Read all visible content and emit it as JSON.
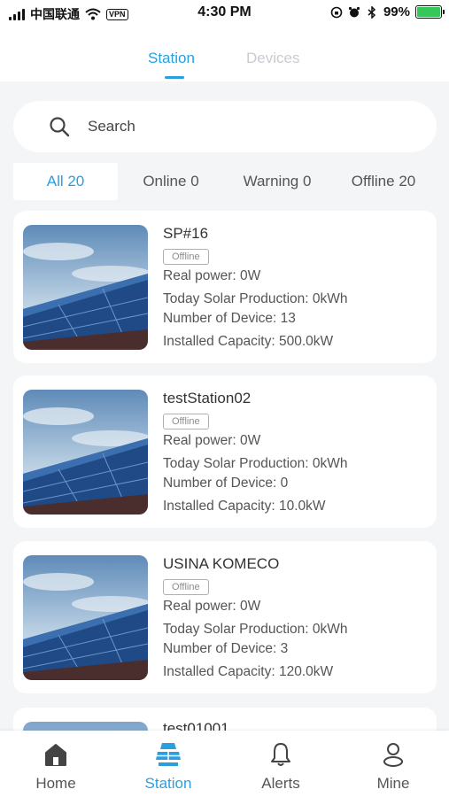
{
  "status_bar": {
    "carrier": "中国联通",
    "vpn": "VPN",
    "time": "4:30 PM",
    "battery": "99%"
  },
  "top_tabs": [
    {
      "label": "Station",
      "active": true
    },
    {
      "label": "Devices",
      "active": false
    }
  ],
  "search": {
    "placeholder": "Search",
    "value": ""
  },
  "filters": [
    {
      "label": "All 20",
      "active": true
    },
    {
      "label": "Online 0",
      "active": false
    },
    {
      "label": "Warning 0",
      "active": false
    },
    {
      "label": "Offline 20",
      "active": false
    }
  ],
  "stations": [
    {
      "name": "SP#16",
      "status": "Offline",
      "real_power": "Real power: 0W",
      "today_production": "Today Solar Production: 0kWh",
      "device_count": "Number of Device: 13",
      "capacity": "Installed Capacity: 500.0kW"
    },
    {
      "name": "testStation02",
      "status": "Offline",
      "real_power": "Real power: 0W",
      "today_production": "Today Solar Production: 0kWh",
      "device_count": "Number of Device: 0",
      "capacity": "Installed Capacity: 10.0kW"
    },
    {
      "name": "USINA KOMECO",
      "status": "Offline",
      "real_power": "Real power: 0W",
      "today_production": "Today Solar Production: 0kWh",
      "device_count": "Number of Device: 3",
      "capacity": "Installed Capacity: 120.0kW"
    },
    {
      "name": "test01001"
    }
  ],
  "bottom_nav": [
    {
      "label": "Home",
      "icon": "home-icon",
      "active": false
    },
    {
      "label": "Station",
      "icon": "solar-panel-icon",
      "active": true
    },
    {
      "label": "Alerts",
      "icon": "bell-icon",
      "active": false
    },
    {
      "label": "Mine",
      "icon": "person-icon",
      "active": false
    }
  ],
  "colors": {
    "accent": "#2a9fe0",
    "background": "#f3f5f6",
    "card": "#ffffff",
    "battery_fill": "#35c759"
  }
}
